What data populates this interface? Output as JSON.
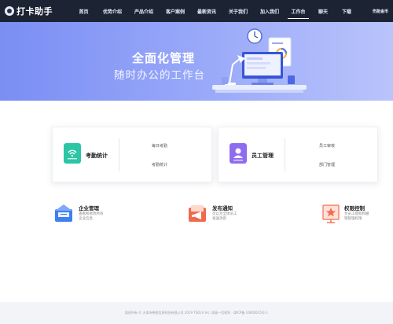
{
  "app": {
    "name": "打卡助手"
  },
  "nav": {
    "items": [
      {
        "label": "首页",
        "active": false
      },
      {
        "label": "优势介绍",
        "active": false
      },
      {
        "label": "产品介绍",
        "active": false
      },
      {
        "label": "客户案例",
        "active": false
      },
      {
        "label": "最新资讯",
        "active": false
      },
      {
        "label": "关于我们",
        "active": false
      },
      {
        "label": "加入我们",
        "active": false
      },
      {
        "label": "工作台",
        "active": true
      },
      {
        "label": "聊天",
        "active": false
      },
      {
        "label": "下载",
        "active": false
      }
    ],
    "login_label": "伤能金币"
  },
  "banner": {
    "title": "全面化管理",
    "subtitle": "随时办公的工作台"
  },
  "cards": [
    {
      "title": "考勤统计",
      "links": [
        "每日考勤",
        "考勤统计"
      ],
      "icon": "attendance-icon",
      "color": "#2cc5a6"
    },
    {
      "title": "员工管理",
      "links": [
        "员工审核",
        "部门管理"
      ],
      "icon": "employee-icon",
      "color": "#8e6cf0"
    }
  ],
  "features": [
    {
      "title": "企业管理",
      "desc": "查看和修改所有企业信息",
      "icon": "company-icon",
      "color": "#3f7ff2"
    },
    {
      "title": "发布通知",
      "desc": "可以为全体员工发送消息",
      "icon": "notice-icon",
      "color": "#f06a4d"
    },
    {
      "title": "权限控制",
      "desc": "为员工授权和撤销管理权限",
      "icon": "permission-icon",
      "color": "#f26d51"
    }
  ],
  "footer": {
    "text": "版权所有 © 天津市畅悦信息科技有限公司 2019 TSOLA Inc. 保留一切权利 · 津ICP备 16000015号-1"
  }
}
